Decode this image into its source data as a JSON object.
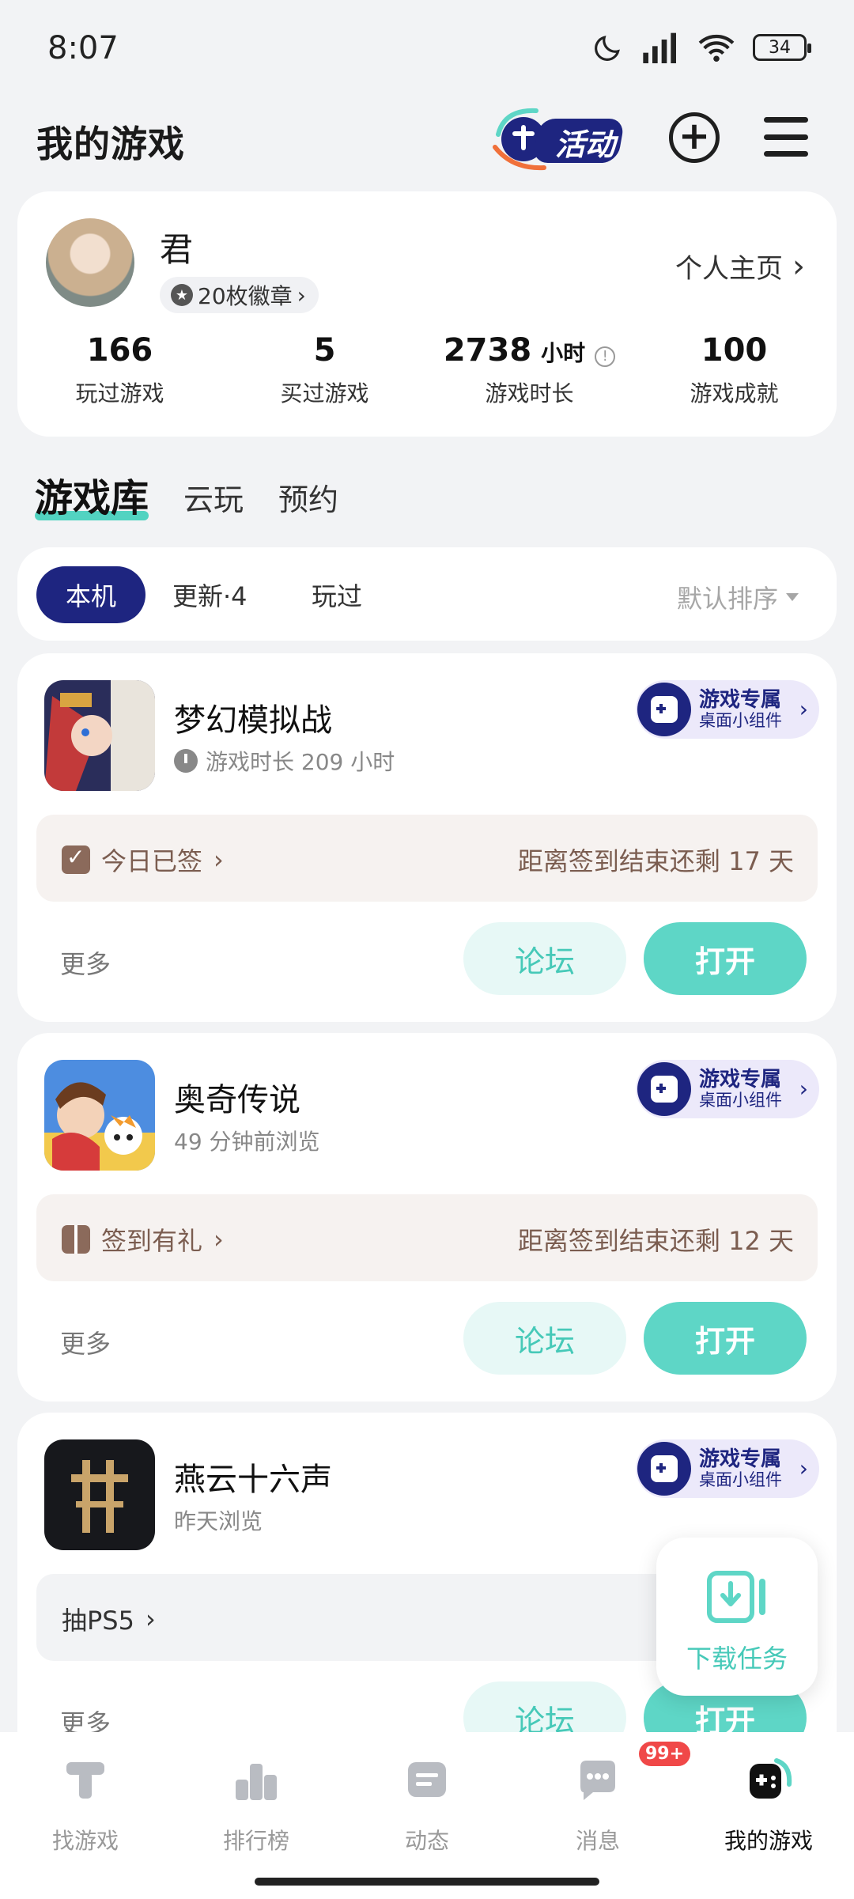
{
  "status_bar": {
    "time": "8:07",
    "battery": "34"
  },
  "header": {
    "title": "我的游戏",
    "activity_label": "活动"
  },
  "profile": {
    "name": "君",
    "badges": "20枚徽章",
    "homepage_link": "个人主页",
    "stats": [
      {
        "value": "166",
        "unit": "",
        "label": "玩过游戏"
      },
      {
        "value": "5",
        "unit": "",
        "label": "买过游戏"
      },
      {
        "value": "2738",
        "unit": "小时",
        "label": "游戏时长"
      },
      {
        "value": "100",
        "unit": "",
        "label": "游戏成就"
      }
    ]
  },
  "library_tabs": [
    {
      "label": "游戏库",
      "active": true
    },
    {
      "label": "云玩",
      "active": false
    },
    {
      "label": "预约",
      "active": false
    }
  ],
  "filters": {
    "chips": [
      {
        "label": "本机",
        "active": true
      },
      {
        "label": "更新·4",
        "active": false
      },
      {
        "label": "玩过",
        "active": false
      }
    ],
    "sort_label": "默认排序"
  },
  "widget": {
    "title": "游戏专属",
    "subtitle": "桌面小组件"
  },
  "games": [
    {
      "name": "梦幻模拟战",
      "subtitle": "游戏时长 209 小时",
      "signin_label": "今日已签",
      "signin_remaining": "距离签到结束还剩 17 天",
      "more": "更多",
      "forum": "论坛",
      "open": "打开"
    },
    {
      "name": "奥奇传说",
      "subtitle": "49 分钟前浏览",
      "signin_label": "签到有礼",
      "signin_remaining": "距离签到结束还剩 12 天",
      "more": "更多",
      "forum": "论坛",
      "open": "打开"
    },
    {
      "name": "燕云十六声",
      "subtitle": "昨天浏览",
      "signin_label": "抽PS5",
      "signin_remaining": "",
      "more": "更多",
      "forum": "论坛",
      "open": "打开"
    }
  ],
  "download_task": {
    "label": "下载任务"
  },
  "bottom_nav": [
    {
      "label": "找游戏",
      "icon": "find-games-icon"
    },
    {
      "label": "排行榜",
      "icon": "ranking-icon"
    },
    {
      "label": "动态",
      "icon": "feed-icon"
    },
    {
      "label": "消息",
      "icon": "message-icon",
      "badge": "99+"
    },
    {
      "label": "我的游戏",
      "icon": "my-games-icon",
      "active": true
    }
  ],
  "colors": {
    "accent": "#5ed6c6",
    "navy": "#1e2580",
    "signin_text": "#7b5d50"
  }
}
